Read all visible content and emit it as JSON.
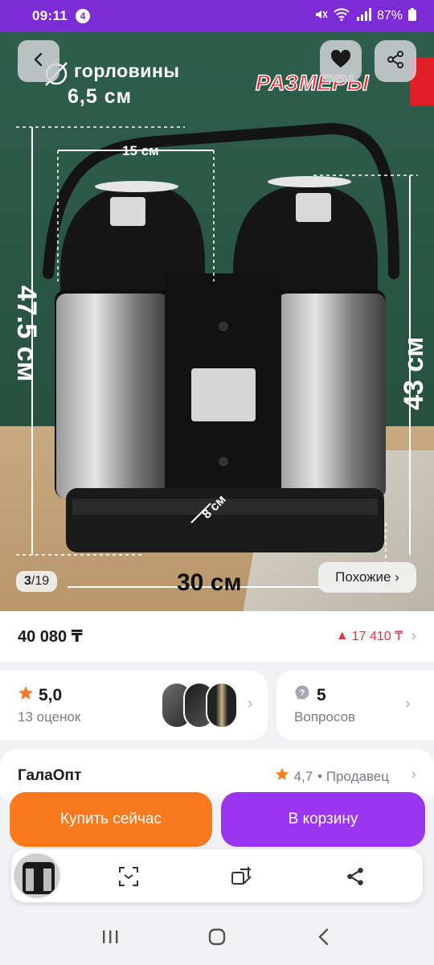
{
  "status_bar": {
    "time": "09:11",
    "notification_count": "4",
    "battery": "87%"
  },
  "gallery": {
    "overlay": {
      "neck_label": "горловины",
      "neck_value": "6,5 см",
      "sizes_title": "РАЗМЕРЫ",
      "diameter": "15 см",
      "height_total": "47.5 см",
      "height_body": "43 см",
      "width": "30 см",
      "depth": "8 см"
    },
    "counter_current": "3",
    "counter_total": "/19",
    "similar_label": "Похожие ›"
  },
  "price": {
    "current": "40 080 ₸",
    "old": "17 410 ₸"
  },
  "rating": {
    "value": "5,0",
    "count_label": "13 оценок"
  },
  "questions": {
    "count": "5",
    "label": "Вопросов"
  },
  "seller": {
    "name": "ГалаОпт",
    "rating": "4,7",
    "role": "• Продавец"
  },
  "actions": {
    "buy_now": "Купить сейчас",
    "add_to_cart": "В корзину"
  },
  "colors": {
    "status_bar": "#7d2bd6",
    "buy_now": "#f9791f",
    "add_to_cart": "#9a36f0",
    "old_price": "#e0334a",
    "star": "#f9791f"
  },
  "icons": {
    "toolbar": [
      "scan-icon",
      "add-to-compare-icon",
      "share-icon"
    ],
    "nav": [
      "recent-apps-icon",
      "home-icon",
      "back-icon"
    ]
  }
}
